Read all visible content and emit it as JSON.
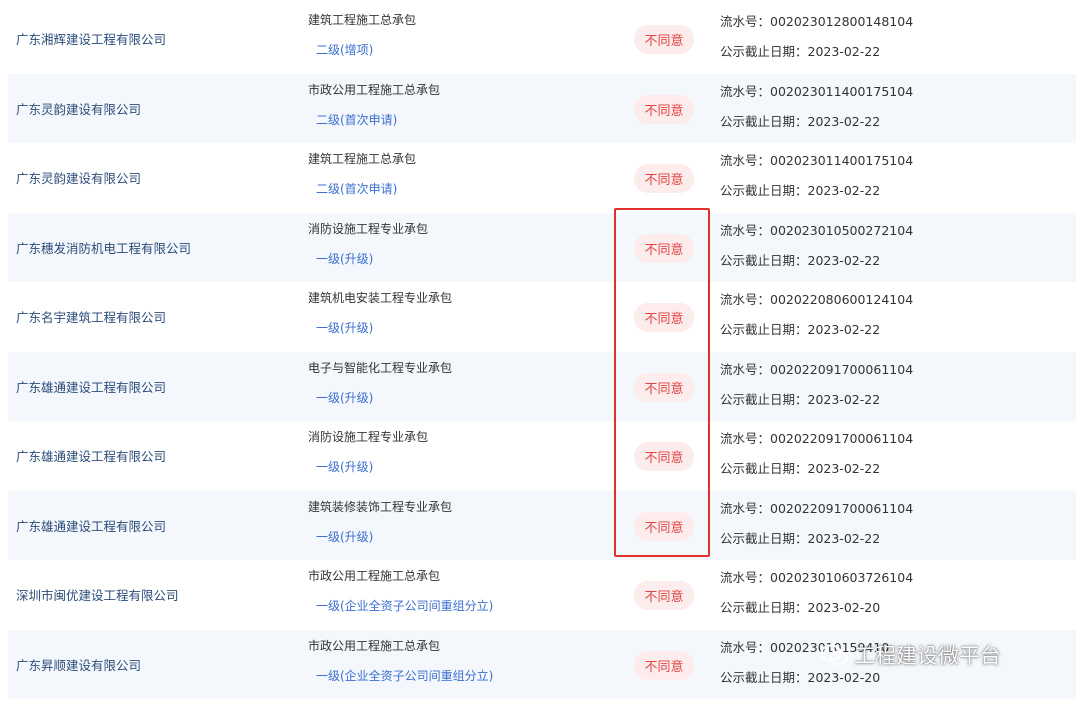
{
  "rows": [
    {
      "company": "广东湘辉建设工程有限公司",
      "qualification": "建筑工程施工总承包",
      "level": "二级(增项)",
      "status": "不同意",
      "serial": "流水号：002023012800148104",
      "deadline": "公示截止日期：2023-02-22"
    },
    {
      "company": "广东灵韵建设有限公司",
      "qualification": "市政公用工程施工总承包",
      "level": "二级(首次申请)",
      "status": "不同意",
      "serial": "流水号：002023011400175104",
      "deadline": "公示截止日期：2023-02-22"
    },
    {
      "company": "广东灵韵建设有限公司",
      "qualification": "建筑工程施工总承包",
      "level": "二级(首次申请)",
      "status": "不同意",
      "serial": "流水号：002023011400175104",
      "deadline": "公示截止日期：2023-02-22"
    },
    {
      "company": "广东穗发消防机电工程有限公司",
      "qualification": "消防设施工程专业承包",
      "level": "一级(升级)",
      "status": "不同意",
      "serial": "流水号：002023010500272104",
      "deadline": "公示截止日期：2023-02-22"
    },
    {
      "company": "广东名宇建筑工程有限公司",
      "qualification": "建筑机电安装工程专业承包",
      "level": "一级(升级)",
      "status": "不同意",
      "serial": "流水号：002022080600124104",
      "deadline": "公示截止日期：2023-02-22"
    },
    {
      "company": "广东雄通建设工程有限公司",
      "qualification": "电子与智能化工程专业承包",
      "level": "一级(升级)",
      "status": "不同意",
      "serial": "流水号：002022091700061104",
      "deadline": "公示截止日期：2023-02-22"
    },
    {
      "company": "广东雄通建设工程有限公司",
      "qualification": "消防设施工程专业承包",
      "level": "一级(升级)",
      "status": "不同意",
      "serial": "流水号：002022091700061104",
      "deadline": "公示截止日期：2023-02-22"
    },
    {
      "company": "广东雄通建设工程有限公司",
      "qualification": "建筑装修装饰工程专业承包",
      "level": "一级(升级)",
      "status": "不同意",
      "serial": "流水号：002022091700061104",
      "deadline": "公示截止日期：2023-02-22"
    },
    {
      "company": "深圳市闽优建设工程有限公司",
      "qualification": "市政公用工程施工总承包",
      "level": "一级(企业全资子公司间重组分立)",
      "status": "不同意",
      "serial": "流水号：002023010603726104",
      "deadline": "公示截止日期：2023-02-20"
    },
    {
      "company": "广东昇顺建设有限公司",
      "qualification": "市政公用工程施工总承包",
      "level": "一级(企业全资子公司间重组分立)",
      "status": "不同意",
      "serial": "流水号：002023010159410",
      "deadline": "公示截止日期：2023-02-20"
    }
  ],
  "watermark": {
    "text": "工程建设微平台",
    "icon": "wechat-icon"
  },
  "colors": {
    "badge_text": "#e04545",
    "badge_bg": "#fdecec",
    "highlight": "#e0302c",
    "link": "#3b6fd0",
    "company": "#2c4d7a"
  }
}
